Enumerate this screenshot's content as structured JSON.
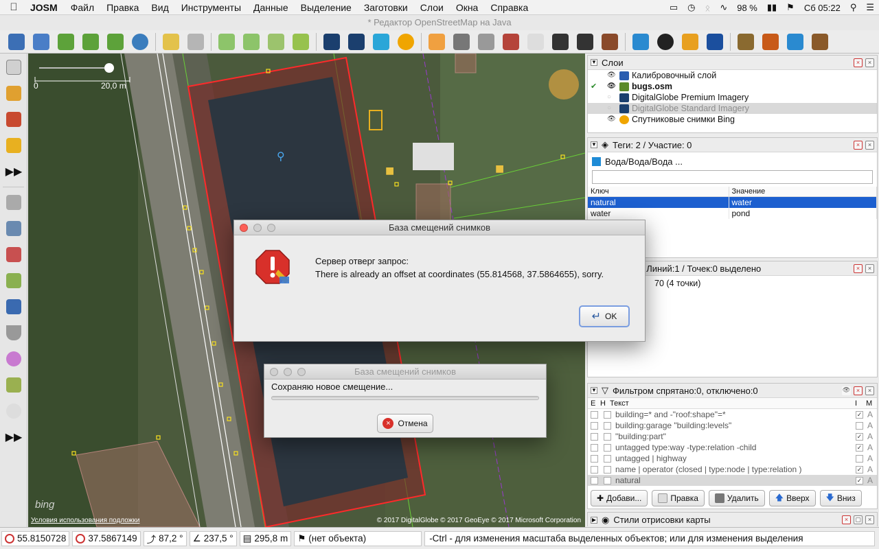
{
  "menubar": {
    "app": "JOSM",
    "items": [
      "Файл",
      "Правка",
      "Вид",
      "Инструменты",
      "Данные",
      "Выделение",
      "Заготовки",
      "Слои",
      "Окна",
      "Справка"
    ],
    "battery": "98 %",
    "clock": "Сб 05:22"
  },
  "window": {
    "title": "* Редактор OpenStreetMap на Java"
  },
  "map": {
    "scale_zero": "0",
    "scale_label": "20,0 m",
    "bing": "bing",
    "terms": "Условия использования подложки",
    "copyright": "© 2017 DigitalGlobe © 2017 GeoEye © 2017 Microsoft Corporation"
  },
  "layers": {
    "title": "Слои",
    "items": [
      {
        "name": "Калибровочный слой",
        "color": "#2a5db0"
      },
      {
        "name": "bugs.osm",
        "color": "#5a8a2a"
      },
      {
        "name": "DigitalGlobe Premium Imagery",
        "color": "#1b3f6e"
      },
      {
        "name": "DigitalGlobe Standard Imagery",
        "color": "#1b3f6e"
      },
      {
        "name": "Спутниковые снимки Bing",
        "color": "#f0a500"
      }
    ]
  },
  "tags": {
    "title": "Теги: 2 / Участие: 0",
    "preset": "Вода/Вода/Вода ...",
    "col_key": "Ключ",
    "col_value": "Значение",
    "rows": [
      {
        "key": "natural",
        "value": "water"
      },
      {
        "key": "water",
        "value": "pond"
      }
    ]
  },
  "selection": {
    "title_partial": "/ Линий:1 / Точек:0 выделено",
    "item_partial": "70 (4 точки)"
  },
  "filter": {
    "title": "Фильтром спрятано:0, отключено:0",
    "col_e": "E",
    "col_h": "H",
    "col_text": "Текст",
    "col_i": "I",
    "col_m": "M",
    "rows": [
      {
        "text": "building=* and -\"roof:shape\"=*",
        "i": true,
        "m": "A"
      },
      {
        "text": "building:garage \"building:levels\"",
        "i": false,
        "m": "A"
      },
      {
        "text": "\"building:part\"",
        "i": true,
        "m": "A"
      },
      {
        "text": "untagged type:way -type:relation  -child",
        "i": true,
        "m": "A"
      },
      {
        "text": "untagged | highway",
        "i": false,
        "m": "A"
      },
      {
        "text": "name | operator (closed |  type:node |  type:relation )",
        "i": true,
        "m": "A"
      },
      {
        "text": "natural",
        "i": true,
        "m": "A"
      }
    ],
    "buttons": {
      "add": "Добави...",
      "edit": "Правка",
      "delete": "Удалить",
      "up": "Вверх",
      "down": "Вниз"
    }
  },
  "styles": {
    "title": "Стили отрисовки карты"
  },
  "status": {
    "lat": "55.8150728",
    "lon": "37.5867149",
    "heading": "87,2 °",
    "angle": "237,5 °",
    "distance": "295,8 m",
    "object": "(нет объекта)",
    "help": "-Ctrl - для изменения масштаба выделенных объектов; или для изменения выделения"
  },
  "error_dialog": {
    "title": "База смещений снимков",
    "line1": "Сервер отверг запрос:",
    "line2": "There is already an offset at coordinates (55.814568, 37.5864655), sorry.",
    "ok": "OK"
  },
  "progress_dialog": {
    "title": "База смещений снимков",
    "message": "Сохраняю новое смещение...",
    "cancel": "Отмена"
  }
}
